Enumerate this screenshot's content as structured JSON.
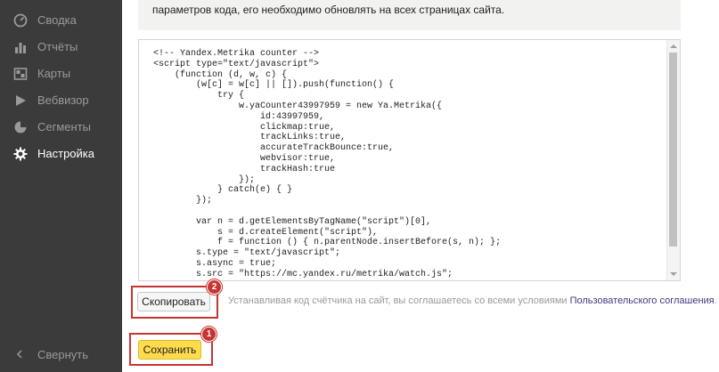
{
  "sidebar": {
    "items": [
      {
        "label": "Сводка",
        "icon": "dashboard-icon"
      },
      {
        "label": "Отчёты",
        "icon": "reports-icon"
      },
      {
        "label": "Карты",
        "icon": "maps-icon"
      },
      {
        "label": "Вебвизор",
        "icon": "webvisor-icon"
      },
      {
        "label": "Сегменты",
        "icon": "segments-icon"
      },
      {
        "label": "Настройка",
        "icon": "settings-icon",
        "active": true
      }
    ],
    "collapse_label": "Свернуть",
    "active_label_color": "#ffffff",
    "inactive_label_color": "#9a9a9a"
  },
  "info": {
    "text": "параметров кода, его необходимо обновлять на всех страницах сайта."
  },
  "code": {
    "lines": [
      "<!-- Yandex.Metrika counter -->",
      "<script type=\"text/javascript\">",
      "    (function (d, w, c) {",
      "        (w[c] = w[c] || []).push(function() {",
      "            try {",
      "                w.yaCounter43997959 = new Ya.Metrika({",
      "                    id:43997959,",
      "                    clickmap:true,",
      "                    trackLinks:true,",
      "                    accurateTrackBounce:true,",
      "                    webvisor:true,",
      "                    trackHash:true",
      "                });",
      "            } catch(e) { }",
      "        });",
      "",
      "        var n = d.getElementsByTagName(\"script\")[0],",
      "            s = d.createElement(\"script\"),",
      "            f = function () { n.parentNode.insertBefore(s, n); };",
      "        s.type = \"text/javascript\";",
      "        s.async = true;",
      "        s.src = \"https://mc.yandex.ru/metrika/watch.js\";"
    ]
  },
  "actions": {
    "copy_label": "Скопировать",
    "copy_step": "2",
    "agreement_text": "Устанавливая код счётчика на сайт, вы соглашаетесь со всеми условиями",
    "agreement_link": "Пользовательского соглашения",
    "agreement_end": ".",
    "save_label": "Сохранить",
    "save_step": "1"
  },
  "colors": {
    "sidebar_bg": "#3b3b3b",
    "save_button": "#ffdb4d",
    "highlight": "#c73431"
  }
}
